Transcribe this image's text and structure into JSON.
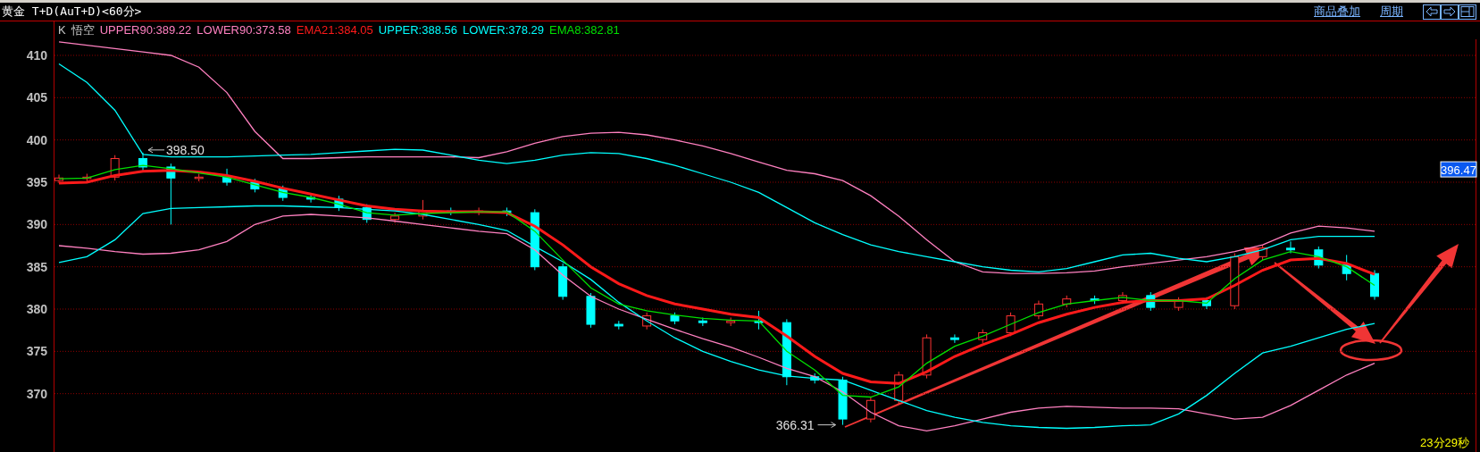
{
  "header": {
    "title": "黄金 T+D(AuT+D)<60分>",
    "links": [
      "商品叠加",
      "周期"
    ],
    "nav_buttons": [
      {
        "kind": "left"
      },
      {
        "kind": "right"
      },
      {
        "kind": "panel"
      }
    ]
  },
  "legend": [
    {
      "text": "K",
      "color": "#c8c8c8"
    },
    {
      "text": "悟空",
      "color": "#c8c8c8"
    },
    {
      "text": "UPPER90:389.22",
      "color": "#ff80c0"
    },
    {
      "text": "LOWER90:373.58",
      "color": "#ff80c0"
    },
    {
      "text": "EMA21:384.05",
      "color": "#ff1a1a"
    },
    {
      "text": "UPPER:388.56",
      "color": "#00ffff"
    },
    {
      "text": "LOWER:378.29",
      "color": "#00ffff"
    },
    {
      "text": "EMA8:382.81",
      "color": "#00e000"
    }
  ],
  "chart_data": {
    "type": "candlestick",
    "grid": true,
    "ylim": [
      363.1,
      411.9
    ],
    "yticks": [
      370,
      375,
      380,
      385,
      390,
      395,
      400,
      405,
      410
    ],
    "ohlc": [
      [
        395.2,
        395.9,
        394.9,
        395.5
      ],
      [
        395.5,
        396.0,
        395.1,
        395.6
      ],
      [
        395.6,
        398.2,
        395.2,
        397.8
      ],
      [
        397.8,
        398.5,
        396.4,
        396.8
      ],
      [
        396.8,
        397.2,
        390.0,
        395.5
      ],
      [
        395.5,
        396.0,
        395.1,
        395.6
      ],
      [
        395.6,
        396.6,
        394.6,
        395.0
      ],
      [
        395.0,
        395.4,
        393.8,
        394.2
      ],
      [
        394.2,
        394.6,
        392.8,
        393.2
      ],
      [
        393.2,
        393.6,
        392.6,
        393.0
      ],
      [
        393.0,
        393.4,
        391.6,
        392.0
      ],
      [
        392.0,
        392.4,
        390.2,
        390.6
      ],
      [
        390.6,
        391.4,
        390.2,
        391.0
      ],
      [
        391.0,
        392.9,
        390.6,
        391.6
      ],
      [
        391.6,
        392.0,
        391.1,
        391.5
      ],
      [
        391.5,
        392.0,
        391.1,
        391.6
      ],
      [
        391.6,
        392.0,
        391.0,
        391.4
      ],
      [
        391.4,
        391.8,
        384.6,
        385.0
      ],
      [
        385.0,
        385.4,
        381.1,
        381.5
      ],
      [
        381.5,
        381.9,
        377.8,
        378.2
      ],
      [
        378.2,
        378.6,
        377.6,
        378.0
      ],
      [
        378.0,
        379.6,
        377.6,
        379.2
      ],
      [
        379.2,
        379.6,
        378.2,
        378.6
      ],
      [
        378.6,
        379.0,
        378.0,
        378.4
      ],
      [
        378.4,
        379.0,
        378.0,
        378.6
      ],
      [
        378.6,
        379.8,
        377.6,
        378.4
      ],
      [
        378.4,
        378.8,
        371.0,
        372.0
      ],
      [
        372.0,
        372.4,
        371.2,
        371.6
      ],
      [
        371.6,
        372.0,
        366.31,
        367.0
      ],
      [
        367.0,
        369.6,
        366.6,
        369.2
      ],
      [
        369.2,
        372.6,
        368.8,
        372.2
      ],
      [
        372.2,
        377.0,
        371.8,
        376.6
      ],
      [
        376.6,
        377.0,
        376.0,
        376.4
      ],
      [
        376.4,
        377.6,
        376.0,
        377.2
      ],
      [
        377.2,
        379.6,
        376.8,
        379.2
      ],
      [
        379.2,
        381.0,
        378.8,
        380.6
      ],
      [
        380.6,
        381.6,
        380.2,
        381.2
      ],
      [
        381.2,
        381.6,
        380.6,
        381.0
      ],
      [
        381.0,
        382.0,
        380.6,
        381.6
      ],
      [
        381.6,
        382.0,
        379.8,
        380.2
      ],
      [
        380.2,
        381.4,
        379.8,
        381.0
      ],
      [
        381.0,
        381.4,
        380.0,
        380.4
      ],
      [
        380.4,
        386.6,
        380.0,
        386.2
      ],
      [
        386.2,
        387.6,
        385.8,
        387.2
      ],
      [
        387.2,
        388.0,
        386.6,
        387.0
      ],
      [
        387.0,
        387.4,
        384.8,
        385.2
      ],
      [
        385.2,
        386.4,
        383.4,
        384.2
      ],
      [
        384.2,
        384.6,
        381.1,
        381.5
      ]
    ],
    "series": [
      {
        "type": "line",
        "color": "#ff80c0",
        "values": [
          411.6,
          411.2,
          410.8,
          410.4,
          410.0,
          408.6,
          405.6,
          401.0,
          397.8,
          397.8,
          397.9,
          398.0,
          398.0,
          398.0,
          398.0,
          397.9,
          398.6,
          399.6,
          400.4,
          400.8,
          400.9,
          400.6,
          400.0,
          399.3,
          398.4,
          397.4,
          396.4,
          396.0,
          395.2,
          393.4,
          391.0,
          388.2,
          385.6,
          384.4,
          384.2,
          384.2,
          384.3,
          384.5,
          385.0,
          385.4,
          385.8,
          386.2,
          386.8,
          387.6,
          389.0,
          389.8,
          389.6,
          389.2
        ]
      },
      {
        "type": "line",
        "color": "#ff80c0",
        "values": [
          387.5,
          387.2,
          386.8,
          386.5,
          386.6,
          387.0,
          388.0,
          390.0,
          391.0,
          391.2,
          391.0,
          390.8,
          390.4,
          390.0,
          389.6,
          389.2,
          388.9,
          387.0,
          384.0,
          381.5,
          380.0,
          378.8,
          377.6,
          376.5,
          375.5,
          374.3,
          373.0,
          372.0,
          370.2,
          367.8,
          366.2,
          365.6,
          366.2,
          367.0,
          367.8,
          368.3,
          368.5,
          368.4,
          368.3,
          368.3,
          368.2,
          367.6,
          367.0,
          367.2,
          368.6,
          370.4,
          372.2,
          373.6
        ]
      },
      {
        "type": "line",
        "color": "#ff1a1a",
        "values": [
          394.9,
          395.0,
          395.8,
          396.3,
          396.4,
          396.2,
          395.8,
          395.1,
          394.3,
          393.6,
          392.9,
          392.2,
          391.8,
          391.6,
          391.5,
          391.5,
          391.4,
          389.8,
          387.6,
          385.0,
          383.0,
          381.6,
          380.6,
          380.0,
          379.4,
          379.0,
          376.8,
          374.4,
          372.4,
          371.4,
          371.2,
          372.6,
          374.4,
          375.8,
          377.0,
          378.4,
          379.4,
          380.2,
          380.8,
          381.0,
          381.0,
          381.2,
          382.8,
          384.6,
          385.8,
          386.0,
          385.4,
          384.1
        ]
      },
      {
        "type": "line",
        "color": "#00ffff",
        "values": [
          409.0,
          406.8,
          403.5,
          398.3,
          398.0,
          398.0,
          398.0,
          398.1,
          398.2,
          398.3,
          398.5,
          398.7,
          398.9,
          398.8,
          398.2,
          397.6,
          397.2,
          397.6,
          398.2,
          398.5,
          398.4,
          397.8,
          397.0,
          396.0,
          395.0,
          393.8,
          392.0,
          390.2,
          388.8,
          387.6,
          386.8,
          386.2,
          385.6,
          385.0,
          384.6,
          384.4,
          384.8,
          385.6,
          386.4,
          386.6,
          386.0,
          385.6,
          386.2,
          387.0,
          388.2,
          388.6,
          388.6,
          388.6
        ]
      },
      {
        "type": "line",
        "color": "#00ffff",
        "values": [
          385.5,
          386.2,
          388.2,
          391.3,
          391.9,
          392.0,
          392.1,
          392.2,
          392.2,
          392.1,
          392.0,
          391.8,
          391.6,
          391.2,
          390.6,
          390.0,
          389.3,
          387.4,
          385.6,
          383.5,
          380.8,
          378.6,
          376.6,
          375.0,
          373.8,
          372.8,
          372.1,
          371.8,
          371.6,
          370.4,
          369.2,
          368.0,
          367.2,
          366.6,
          366.2,
          366.0,
          365.9,
          366.0,
          366.2,
          366.3,
          367.6,
          369.8,
          372.4,
          374.8,
          375.6,
          376.6,
          377.6,
          378.3
        ]
      },
      {
        "type": "line",
        "color": "#00e000",
        "values": [
          395.4,
          395.5,
          396.5,
          397.0,
          396.6,
          396.1,
          395.6,
          394.7,
          393.8,
          393.2,
          392.4,
          391.4,
          391.1,
          391.3,
          391.4,
          391.5,
          391.5,
          389.2,
          385.8,
          382.5,
          380.6,
          379.8,
          379.3,
          378.9,
          378.7,
          378.6,
          375.0,
          372.8,
          369.8,
          369.6,
          370.8,
          373.6,
          375.6,
          376.8,
          378.2,
          379.6,
          380.6,
          381.0,
          381.4,
          381.0,
          381.0,
          380.7,
          383.6,
          385.8,
          386.8,
          386.2,
          385.0,
          382.8
        ]
      }
    ],
    "annotations": [
      "398.50",
      "366.31"
    ]
  },
  "price_tag": "396.47",
  "countdown": "23分29秒"
}
